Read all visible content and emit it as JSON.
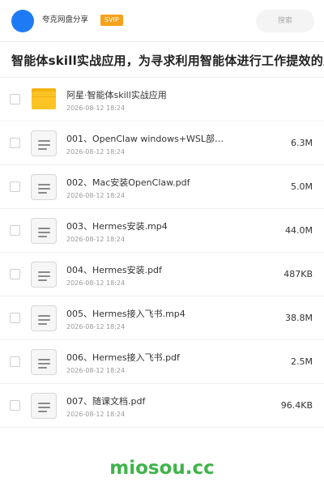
{
  "header": {
    "user_name": "夸克网盘分享",
    "badge": "SVIP",
    "search_placeholder": "搜索"
  },
  "page_title": "智能体skill实战应用，为寻求利用智能体进行工作提效的人",
  "files": [
    {
      "type": "folder",
      "name": "阿星·智能体skill实战应用",
      "date": "2026-08-12 18:24",
      "size": ""
    },
    {
      "type": "doc",
      "name": "001、OpenClaw windows+WSL部…",
      "date": "2026-08-12 18:24",
      "size": "6.3M"
    },
    {
      "type": "doc",
      "name": "002、Mac安装OpenClaw.pdf",
      "date": "2026-08-12 18:24",
      "size": "5.0M"
    },
    {
      "type": "doc",
      "name": "003、Hermes安装.mp4",
      "date": "2026-08-12 18:24",
      "size": "44.0M"
    },
    {
      "type": "doc",
      "name": "004、Hermes安装.pdf",
      "date": "2026-08-12 18:24",
      "size": "487KB"
    },
    {
      "type": "doc",
      "name": "005、Hermes接入飞书.mp4",
      "date": "2026-08-12 18:24",
      "size": "38.8M"
    },
    {
      "type": "doc",
      "name": "006、Hermes接入飞书.pdf",
      "date": "2026-08-12 18:24",
      "size": "2.5M"
    },
    {
      "type": "doc",
      "name": "007、随课文档.pdf",
      "date": "2026-08-12 18:24",
      "size": "96.4KB"
    }
  ],
  "watermark": "miosou.cc",
  "colors": {
    "avatar": "#1e7bf5",
    "svip_badge": "#f7a21b",
    "folder": "#fcc325",
    "watermark": "#3fb34a"
  },
  "icons": {
    "folder": "folder-icon",
    "doc": "document-icon",
    "checkbox": "checkbox-icon"
  }
}
